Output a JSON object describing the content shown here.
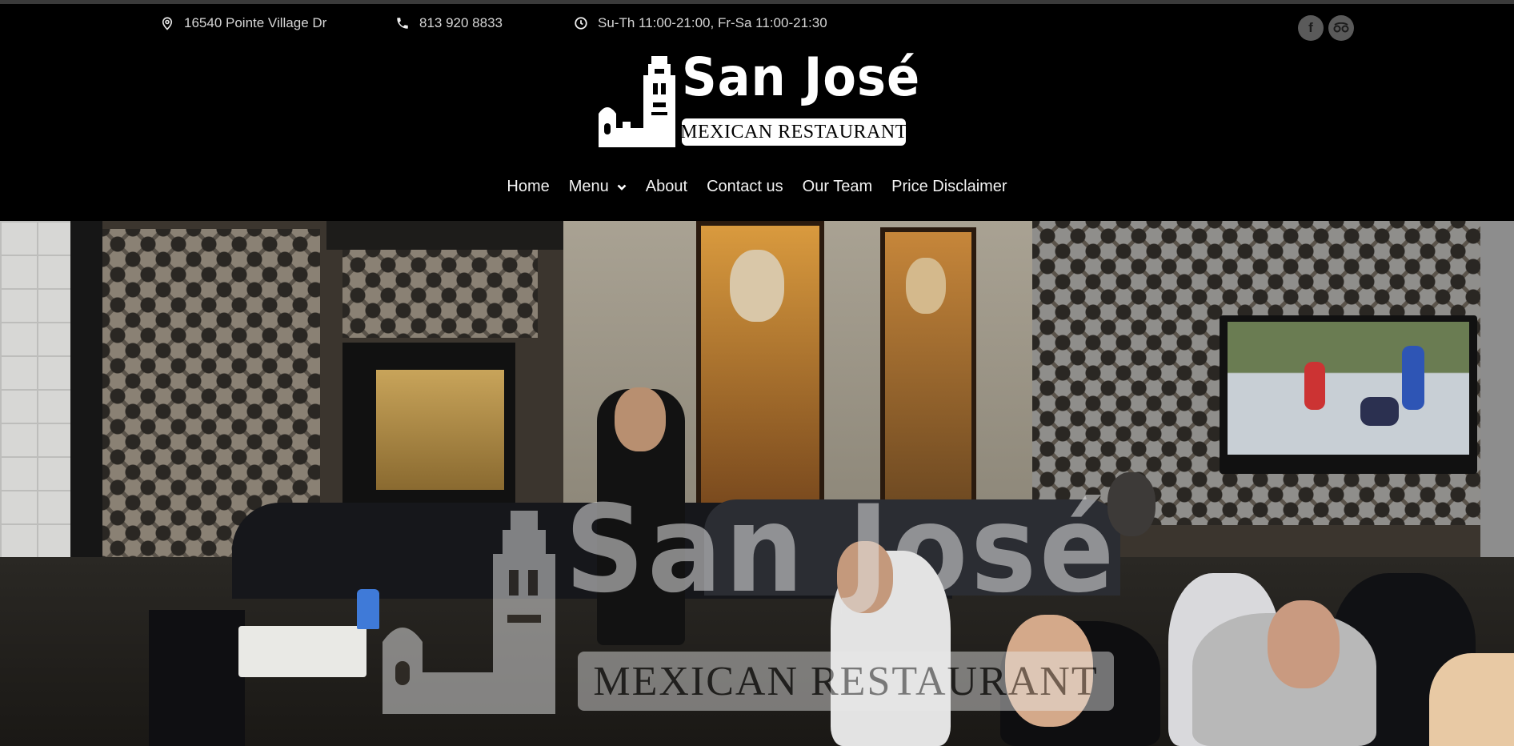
{
  "topbar": {
    "address": "16540 Pointe Village Dr",
    "phone": "813 920 8833",
    "hours": "Su-Th 11:00-21:00, Fr-Sa 11:00-21:30",
    "social": [
      {
        "label": "f",
        "icon": "facebook-icon"
      },
      {
        "label": "oo",
        "icon": "tripadvisor-icon"
      }
    ]
  },
  "logo": {
    "title": "San José",
    "subtitle": "MEXICAN RESTAURANT"
  },
  "nav": {
    "items": [
      {
        "label": "Home"
      },
      {
        "label": "Menu",
        "has_dropdown": true
      },
      {
        "label": "About"
      },
      {
        "label": "Contact us"
      },
      {
        "label": "Our Team"
      },
      {
        "label": "Price Disclaimer"
      }
    ]
  },
  "hero": {
    "watermark_title": "San José",
    "watermark_subtitle": "MEXICAN RESTAURANT"
  },
  "colors": {
    "header_bg": "#000000",
    "text": "#ffffff",
    "muted_text": "#d6d6d6",
    "social_bg": "#5a5a5a"
  }
}
